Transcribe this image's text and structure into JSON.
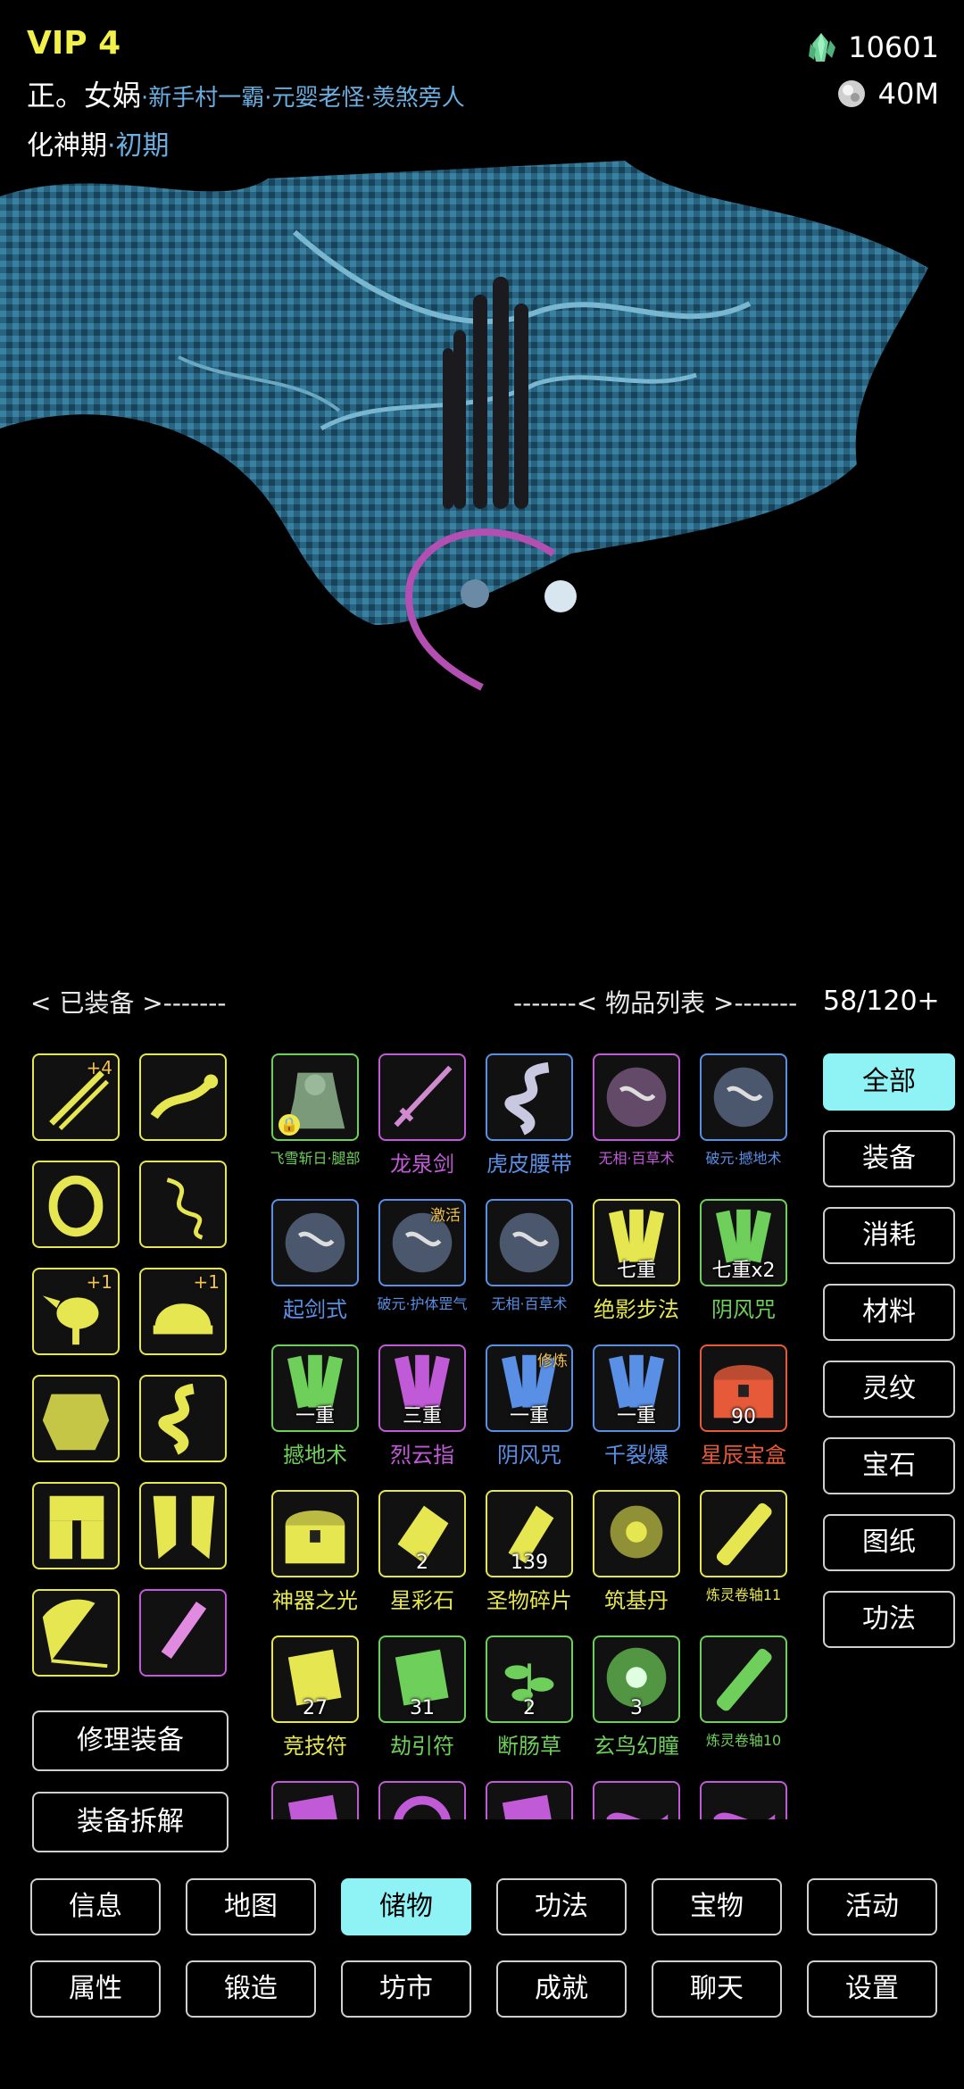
{
  "header": {
    "vip": "VIP 4",
    "player_name": "正。女娲",
    "titles": "·新手村一霸·元婴老怪·羡煞旁人",
    "realm_name": "化神期",
    "realm_stage": "·初期",
    "jade": "10601",
    "silver": "40M"
  },
  "colors": {
    "accent": "#8ff3f6",
    "vip": "#f2f04a",
    "title_blue": "#6aaee0",
    "tier_yellow": "#e6e650",
    "tier_green": "#6ecf5a",
    "tier_blue": "#5a8fe6",
    "tier_purple": "#c05ad6",
    "tier_red": "#e65a3a"
  },
  "sections": {
    "equipped": "< 已装备 >-------",
    "items": "-------< 物品列表 >-------",
    "capacity": "58/120+"
  },
  "equipped": [
    {
      "icon": "twin-sword-icon",
      "plus": "+4"
    },
    {
      "icon": "snake-whip-icon",
      "plus": ""
    },
    {
      "icon": "ring-icon",
      "plus": ""
    },
    {
      "icon": "spirit-serpent-icon",
      "plus": ""
    },
    {
      "icon": "golden-bird-icon",
      "plus": "+1"
    },
    {
      "icon": "helmet-icon",
      "plus": "+1"
    },
    {
      "icon": "armor-icon",
      "plus": ""
    },
    {
      "icon": "coiled-belt-icon",
      "plus": ""
    },
    {
      "icon": "leg-armor-icon",
      "plus": ""
    },
    {
      "icon": "boots-icon",
      "plus": ""
    },
    {
      "icon": "fan-icon",
      "plus": ""
    },
    {
      "icon": "pink-scroll-icon",
      "plus": ""
    }
  ],
  "equip_actions": {
    "repair": "修理装备",
    "dismantle": "装备拆解"
  },
  "items": [
    {
      "name": "飞雪斩日·腿部",
      "tier": "green",
      "icon": "jade-statue-icon",
      "qty": "",
      "tag": "",
      "locked": true
    },
    {
      "name": "龙泉剑",
      "tier": "purple",
      "icon": "sword-icon",
      "qty": "",
      "tag": "",
      "locked": false
    },
    {
      "name": "虎皮腰带",
      "tier": "blue",
      "icon": "belt-icon",
      "qty": "",
      "tag": "",
      "locked": false
    },
    {
      "name": "无相·百草术",
      "tier": "purple",
      "icon": "skill-orb-icon",
      "qty": "",
      "tag": "",
      "locked": false
    },
    {
      "name": "破元·撼地术",
      "tier": "blue",
      "icon": "skill-orb-icon",
      "qty": "",
      "tag": "",
      "locked": false
    },
    {
      "name": "起剑式",
      "tier": "blue",
      "icon": "skill-orb-icon",
      "qty": "",
      "tag": "",
      "locked": false
    },
    {
      "name": "破元·护体罡气",
      "tier": "blue",
      "icon": "skill-orb-icon",
      "qty": "",
      "tag": "激活",
      "locked": false
    },
    {
      "name": "无相·百草术",
      "tier": "blue",
      "icon": "skill-orb-icon",
      "qty": "",
      "tag": "",
      "locked": false
    },
    {
      "name": "绝影步法",
      "tier": "yellow",
      "icon": "manual-icon",
      "qty": "七重",
      "tag": "",
      "locked": false
    },
    {
      "name": "阴风咒",
      "tier": "green",
      "icon": "manual-icon",
      "qty": "七重x2",
      "tag": "",
      "locked": false
    },
    {
      "name": "撼地术",
      "tier": "green",
      "icon": "manual-icon",
      "qty": "一重",
      "tag": "",
      "locked": false
    },
    {
      "name": "烈云指",
      "tier": "purple",
      "icon": "manual-icon",
      "qty": "三重",
      "tag": "",
      "locked": false
    },
    {
      "name": "阴风咒",
      "tier": "blue",
      "icon": "manual-icon",
      "qty": "一重",
      "tag": "修炼",
      "locked": false
    },
    {
      "name": "千裂爆",
      "tier": "blue",
      "icon": "manual-icon",
      "qty": "一重",
      "tag": "",
      "locked": false
    },
    {
      "name": "星辰宝盒",
      "tier": "red",
      "icon": "chest-icon",
      "qty": "90",
      "tag": "",
      "locked": false
    },
    {
      "name": "神器之光",
      "tier": "yellow",
      "icon": "chest-icon",
      "qty": "",
      "tag": "",
      "locked": false
    },
    {
      "name": "星彩石",
      "tier": "yellow",
      "icon": "gem-icon",
      "qty": "2",
      "tag": "",
      "locked": false
    },
    {
      "name": "圣物碎片",
      "tier": "yellow",
      "icon": "shard-icon",
      "qty": "139",
      "tag": "",
      "locked": false
    },
    {
      "name": "筑基丹",
      "tier": "yellow",
      "icon": "flower-pill-icon",
      "qty": "",
      "tag": "",
      "locked": false
    },
    {
      "name": "炼灵卷轴11",
      "tier": "yellow",
      "icon": "scroll-icon",
      "qty": "",
      "tag": "",
      "locked": false
    },
    {
      "name": "竞技符",
      "tier": "yellow",
      "icon": "talisman-icon",
      "qty": "27",
      "tag": "",
      "locked": false
    },
    {
      "name": "劫引符",
      "tier": "green",
      "icon": "talisman-icon",
      "qty": "31",
      "tag": "",
      "locked": false
    },
    {
      "name": "断肠草",
      "tier": "green",
      "icon": "herb-icon",
      "qty": "2",
      "tag": "",
      "locked": false
    },
    {
      "name": "玄鸟幻瞳",
      "tier": "green",
      "icon": "eye-orb-icon",
      "qty": "3",
      "tag": "",
      "locked": false
    },
    {
      "name": "炼灵卷轴10",
      "tier": "green",
      "icon": "scroll-icon",
      "qty": "",
      "tag": "",
      "locked": false
    },
    {
      "name": "",
      "tier": "purple",
      "icon": "talisman-icon",
      "qty": "",
      "tag": "",
      "locked": false
    },
    {
      "name": "",
      "tier": "purple",
      "icon": "bracelet-icon",
      "qty": "",
      "tag": "",
      "locked": false
    },
    {
      "name": "",
      "tier": "purple",
      "icon": "talisman-icon",
      "qty": "",
      "tag": "",
      "locked": false
    },
    {
      "name": "",
      "tier": "purple",
      "icon": "cloth-icon",
      "qty": "",
      "tag": "",
      "locked": false
    },
    {
      "name": "",
      "tier": "purple",
      "icon": "cloth-icon",
      "qty": "",
      "tag": "",
      "locked": false
    }
  ],
  "filters": [
    "全部",
    "装备",
    "消耗",
    "材料",
    "灵纹",
    "宝石",
    "图纸",
    "功法"
  ],
  "active_filter": "全部",
  "nav_row1": [
    "信息",
    "地图",
    "储物",
    "功法",
    "宝物",
    "活动"
  ],
  "nav_row2": [
    "属性",
    "锻造",
    "坊市",
    "成就",
    "聊天",
    "设置"
  ],
  "active_nav": "储物"
}
